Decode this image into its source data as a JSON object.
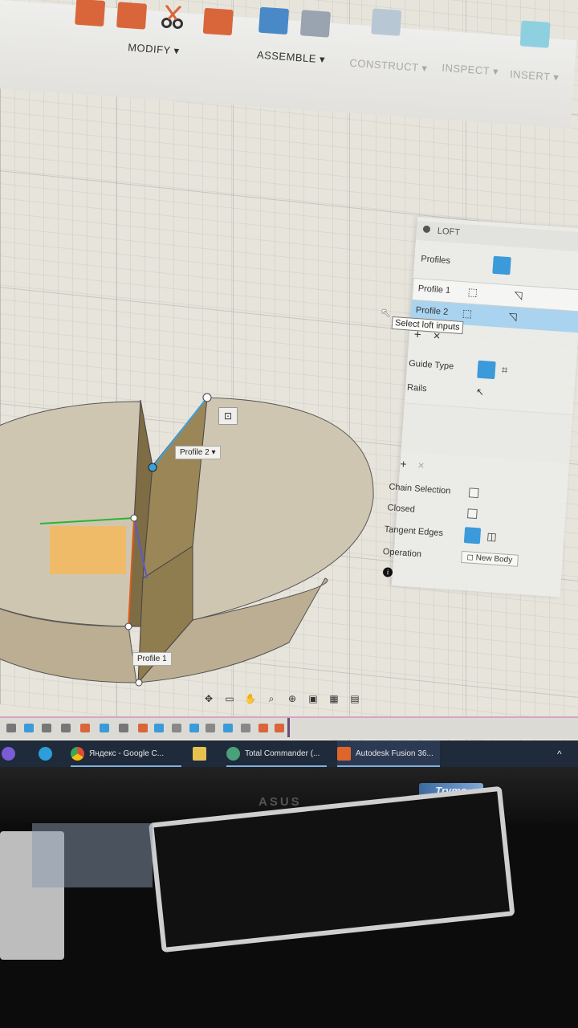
{
  "toolbar": {
    "modify_label": "MODIFY ▾",
    "assemble_label": "ASSEMBLE ▾",
    "construct_label": "CONSTRUCT ▾",
    "inspect_label": "INSPECT ▾",
    "insert_label": "INSERT ▾"
  },
  "loft": {
    "title": "LOFT",
    "profiles_label": "Profiles",
    "profile_rows": [
      "Profile 1",
      "Profile 2"
    ],
    "add_symbol": "+",
    "remove_symbol": "×",
    "guide_type_label": "Guide Type",
    "rails_label": "Rails",
    "chain_selection_label": "Chain Selection",
    "closed_label": "Closed",
    "tangent_edges_label": "Tangent Edges",
    "operation_label": "Operation",
    "operation_value": "New Body"
  },
  "tooltip": {
    "text": "Select loft inputs"
  },
  "model": {
    "profile2_label": "Profile 2",
    "profile1_label": "Profile 1"
  },
  "taskbar": {
    "items": [
      {
        "label": "Яндекс - Google C..."
      },
      {
        "label": "Total Commander (..."
      },
      {
        "label": "Autodesk Fusion 36..."
      }
    ]
  },
  "monitor": {
    "brand": "ASUS",
    "badge": "Trymo"
  },
  "colors": {
    "accent": "#3b9ad9",
    "body_fill": "#c9bfa9",
    "wall_fill": "#8b7a52",
    "sketch_orange": "#f4b85a"
  }
}
